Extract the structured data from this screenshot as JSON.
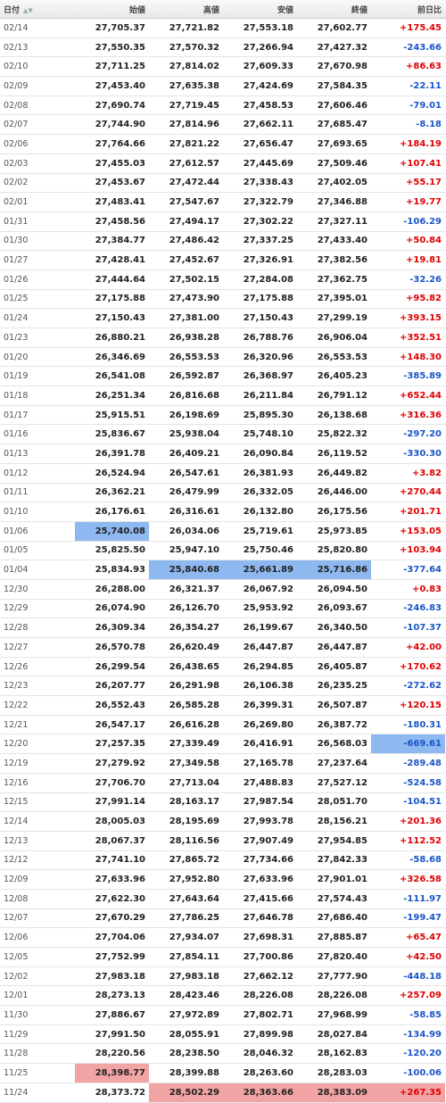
{
  "headers": {
    "date": "日付",
    "sort_glyph": "▲▼",
    "open": "始値",
    "high": "高値",
    "low": "安値",
    "close": "終値",
    "change": "前日比"
  },
  "colors": {
    "positive": "#e00000",
    "negative": "#1a55c8",
    "highlight_low": "#8db8f0",
    "highlight_high": "#f2a4a4"
  },
  "rows": [
    {
      "date": "02/14",
      "open": "27,705.37",
      "high": "27,721.82",
      "low": "27,553.18",
      "close": "27,602.77",
      "change": "+175.45"
    },
    {
      "date": "02/13",
      "open": "27,550.35",
      "high": "27,570.32",
      "low": "27,266.94",
      "close": "27,427.32",
      "change": "-243.66"
    },
    {
      "date": "02/10",
      "open": "27,711.25",
      "high": "27,814.02",
      "low": "27,609.33",
      "close": "27,670.98",
      "change": "+86.63"
    },
    {
      "date": "02/09",
      "open": "27,453.40",
      "high": "27,635.38",
      "low": "27,424.69",
      "close": "27,584.35",
      "change": "-22.11"
    },
    {
      "date": "02/08",
      "open": "27,690.74",
      "high": "27,719.45",
      "low": "27,458.53",
      "close": "27,606.46",
      "change": "-79.01"
    },
    {
      "date": "02/07",
      "open": "27,744.90",
      "high": "27,814.96",
      "low": "27,662.11",
      "close": "27,685.47",
      "change": "-8.18"
    },
    {
      "date": "02/06",
      "open": "27,764.66",
      "high": "27,821.22",
      "low": "27,656.47",
      "close": "27,693.65",
      "change": "+184.19"
    },
    {
      "date": "02/03",
      "open": "27,455.03",
      "high": "27,612.57",
      "low": "27,445.69",
      "close": "27,509.46",
      "change": "+107.41"
    },
    {
      "date": "02/02",
      "open": "27,453.67",
      "high": "27,472.44",
      "low": "27,338.43",
      "close": "27,402.05",
      "change": "+55.17"
    },
    {
      "date": "02/01",
      "open": "27,483.41",
      "high": "27,547.67",
      "low": "27,322.79",
      "close": "27,346.88",
      "change": "+19.77"
    },
    {
      "date": "01/31",
      "open": "27,458.56",
      "high": "27,494.17",
      "low": "27,302.22",
      "close": "27,327.11",
      "change": "-106.29"
    },
    {
      "date": "01/30",
      "open": "27,384.77",
      "high": "27,486.42",
      "low": "27,337.25",
      "close": "27,433.40",
      "change": "+50.84"
    },
    {
      "date": "01/27",
      "open": "27,428.41",
      "high": "27,452.67",
      "low": "27,326.91",
      "close": "27,382.56",
      "change": "+19.81"
    },
    {
      "date": "01/26",
      "open": "27,444.64",
      "high": "27,502.15",
      "low": "27,284.08",
      "close": "27,362.75",
      "change": "-32.26"
    },
    {
      "date": "01/25",
      "open": "27,175.88",
      "high": "27,473.90",
      "low": "27,175.88",
      "close": "27,395.01",
      "change": "+95.82"
    },
    {
      "date": "01/24",
      "open": "27,150.43",
      "high": "27,381.00",
      "low": "27,150.43",
      "close": "27,299.19",
      "change": "+393.15"
    },
    {
      "date": "01/23",
      "open": "26,880.21",
      "high": "26,938.28",
      "low": "26,788.76",
      "close": "26,906.04",
      "change": "+352.51"
    },
    {
      "date": "01/20",
      "open": "26,346.69",
      "high": "26,553.53",
      "low": "26,320.96",
      "close": "26,553.53",
      "change": "+148.30"
    },
    {
      "date": "01/19",
      "open": "26,541.08",
      "high": "26,592.87",
      "low": "26,368.97",
      "close": "26,405.23",
      "change": "-385.89"
    },
    {
      "date": "01/18",
      "open": "26,251.34",
      "high": "26,816.68",
      "low": "26,211.84",
      "close": "26,791.12",
      "change": "+652.44"
    },
    {
      "date": "01/17",
      "open": "25,915.51",
      "high": "26,198.69",
      "low": "25,895.30",
      "close": "26,138.68",
      "change": "+316.36"
    },
    {
      "date": "01/16",
      "open": "25,836.67",
      "high": "25,938.04",
      "low": "25,748.10",
      "close": "25,822.32",
      "change": "-297.20"
    },
    {
      "date": "01/13",
      "open": "26,391.78",
      "high": "26,409.21",
      "low": "26,090.84",
      "close": "26,119.52",
      "change": "-330.30"
    },
    {
      "date": "01/12",
      "open": "26,524.94",
      "high": "26,547.61",
      "low": "26,381.93",
      "close": "26,449.82",
      "change": "+3.82"
    },
    {
      "date": "01/11",
      "open": "26,362.21",
      "high": "26,479.99",
      "low": "26,332.05",
      "close": "26,446.00",
      "change": "+270.44"
    },
    {
      "date": "01/10",
      "open": "26,176.61",
      "high": "26,316.61",
      "low": "26,132.80",
      "close": "26,175.56",
      "change": "+201.71"
    },
    {
      "date": "01/06",
      "open": "25,740.08",
      "high": "26,034.06",
      "low": "25,719.61",
      "close": "25,973.85",
      "change": "+153.05"
    },
    {
      "date": "01/05",
      "open": "25,825.50",
      "high": "25,947.10",
      "low": "25,750.46",
      "close": "25,820.80",
      "change": "+103.94"
    },
    {
      "date": "01/04",
      "open": "25,834.93",
      "high": "25,840.68",
      "low": "25,661.89",
      "close": "25,716.86",
      "change": "-377.64"
    },
    {
      "date": "12/30",
      "open": "26,288.00",
      "high": "26,321.37",
      "low": "26,067.92",
      "close": "26,094.50",
      "change": "+0.83"
    },
    {
      "date": "12/29",
      "open": "26,074.90",
      "high": "26,126.70",
      "low": "25,953.92",
      "close": "26,093.67",
      "change": "-246.83"
    },
    {
      "date": "12/28",
      "open": "26,309.34",
      "high": "26,354.27",
      "low": "26,199.67",
      "close": "26,340.50",
      "change": "-107.37"
    },
    {
      "date": "12/27",
      "open": "26,570.78",
      "high": "26,620.49",
      "low": "26,447.87",
      "close": "26,447.87",
      "change": "+42.00"
    },
    {
      "date": "12/26",
      "open": "26,299.54",
      "high": "26,438.65",
      "low": "26,294.85",
      "close": "26,405.87",
      "change": "+170.62"
    },
    {
      "date": "12/23",
      "open": "26,207.77",
      "high": "26,291.98",
      "low": "26,106.38",
      "close": "26,235.25",
      "change": "-272.62"
    },
    {
      "date": "12/22",
      "open": "26,552.43",
      "high": "26,585.28",
      "low": "26,399.31",
      "close": "26,507.87",
      "change": "+120.15"
    },
    {
      "date": "12/21",
      "open": "26,547.17",
      "high": "26,616.28",
      "low": "26,269.80",
      "close": "26,387.72",
      "change": "-180.31"
    },
    {
      "date": "12/20",
      "open": "27,257.35",
      "high": "27,339.49",
      "low": "26,416.91",
      "close": "26,568.03",
      "change": "-669.61"
    },
    {
      "date": "12/19",
      "open": "27,279.92",
      "high": "27,349.58",
      "low": "27,165.78",
      "close": "27,237.64",
      "change": "-289.48"
    },
    {
      "date": "12/16",
      "open": "27,706.70",
      "high": "27,713.04",
      "low": "27,488.83",
      "close": "27,527.12",
      "change": "-524.58"
    },
    {
      "date": "12/15",
      "open": "27,991.14",
      "high": "28,163.17",
      "low": "27,987.54",
      "close": "28,051.70",
      "change": "-104.51"
    },
    {
      "date": "12/14",
      "open": "28,005.03",
      "high": "28,195.69",
      "low": "27,993.78",
      "close": "28,156.21",
      "change": "+201.36"
    },
    {
      "date": "12/13",
      "open": "28,067.37",
      "high": "28,116.56",
      "low": "27,907.49",
      "close": "27,954.85",
      "change": "+112.52"
    },
    {
      "date": "12/12",
      "open": "27,741.10",
      "high": "27,865.72",
      "low": "27,734.66",
      "close": "27,842.33",
      "change": "-58.68"
    },
    {
      "date": "12/09",
      "open": "27,633.96",
      "high": "27,952.80",
      "low": "27,633.96",
      "close": "27,901.01",
      "change": "+326.58"
    },
    {
      "date": "12/08",
      "open": "27,622.30",
      "high": "27,643.64",
      "low": "27,415.66",
      "close": "27,574.43",
      "change": "-111.97"
    },
    {
      "date": "12/07",
      "open": "27,670.29",
      "high": "27,786.25",
      "low": "27,646.78",
      "close": "27,686.40",
      "change": "-199.47"
    },
    {
      "date": "12/06",
      "open": "27,704.06",
      "high": "27,934.07",
      "low": "27,698.31",
      "close": "27,885.87",
      "change": "+65.47"
    },
    {
      "date": "12/05",
      "open": "27,752.99",
      "high": "27,854.11",
      "low": "27,700.86",
      "close": "27,820.40",
      "change": "+42.50"
    },
    {
      "date": "12/02",
      "open": "27,983.18",
      "high": "27,983.18",
      "low": "27,662.12",
      "close": "27,777.90",
      "change": "-448.18"
    },
    {
      "date": "12/01",
      "open": "28,273.13",
      "high": "28,423.46",
      "low": "28,226.08",
      "close": "28,226.08",
      "change": "+257.09"
    },
    {
      "date": "11/30",
      "open": "27,886.67",
      "high": "27,972.89",
      "low": "27,802.71",
      "close": "27,968.99",
      "change": "-58.85"
    },
    {
      "date": "11/29",
      "open": "27,991.50",
      "high": "28,055.91",
      "low": "27,899.98",
      "close": "28,027.84",
      "change": "-134.99"
    },
    {
      "date": "11/28",
      "open": "28,220.56",
      "high": "28,238.50",
      "low": "28,046.32",
      "close": "28,162.83",
      "change": "-120.20"
    },
    {
      "date": "11/25",
      "open": "28,398.77",
      "high": "28,399.88",
      "low": "28,263.60",
      "close": "28,283.03",
      "change": "-100.06"
    },
    {
      "date": "11/24",
      "open": "28,373.72",
      "high": "28,502.29",
      "low": "28,363.66",
      "close": "28,383.09",
      "change": "+267.35"
    }
  ],
  "highlights": {
    "01/06": {
      "open": "low"
    },
    "01/04": {
      "high": "low",
      "low": "low",
      "close": "low"
    },
    "12/20": {
      "change": "low"
    },
    "11/25": {
      "open": "high"
    },
    "11/24": {
      "high": "high",
      "low": "high",
      "close": "high",
      "change": "high"
    }
  }
}
